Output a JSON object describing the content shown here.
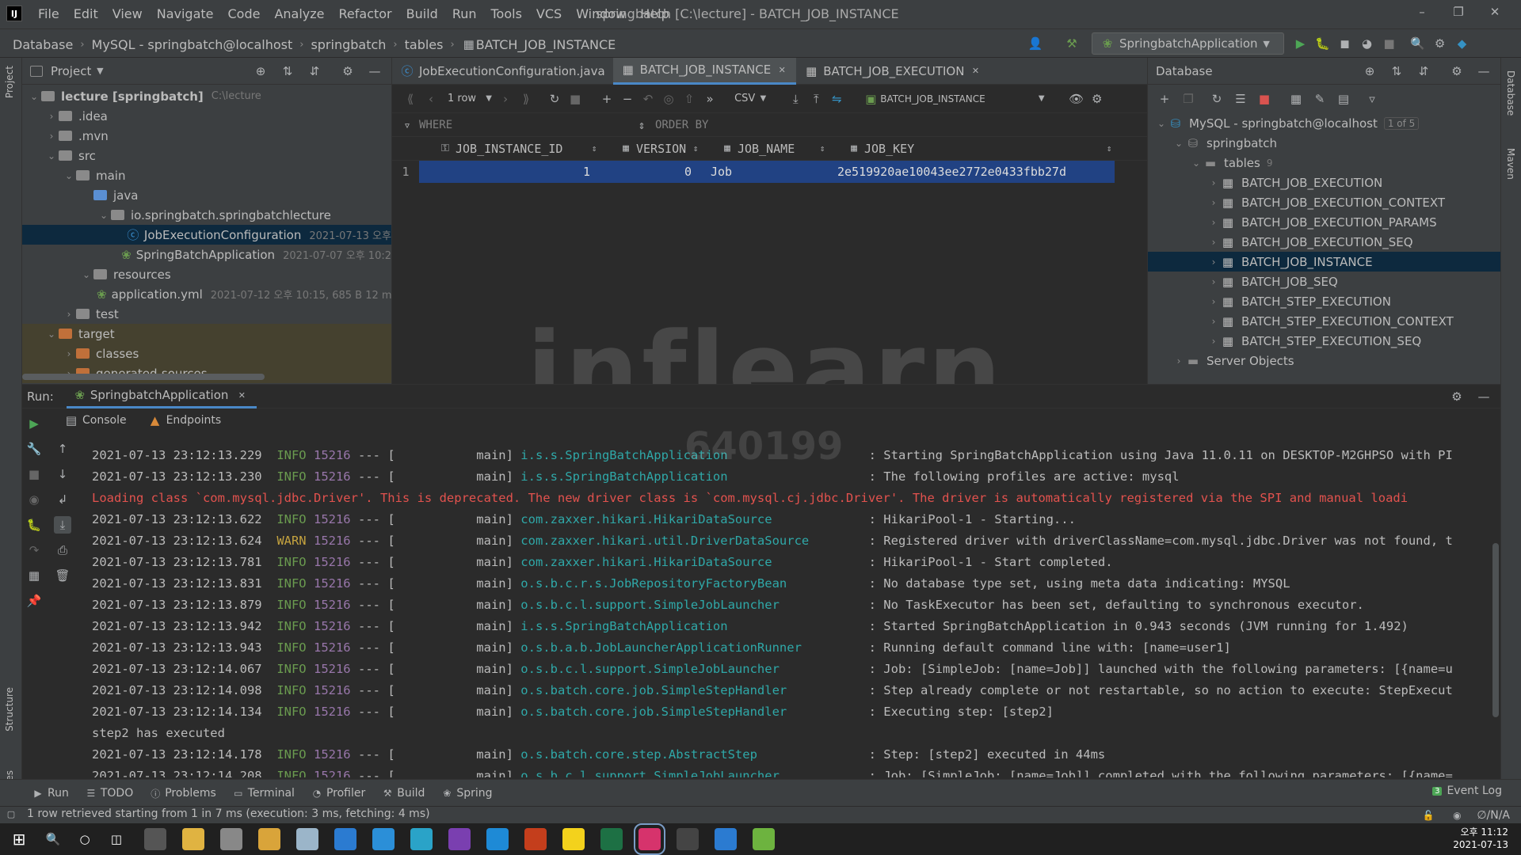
{
  "menu": {
    "items": [
      "File",
      "Edit",
      "View",
      "Navigate",
      "Code",
      "Analyze",
      "Refactor",
      "Build",
      "Run",
      "Tools",
      "VCS",
      "Window",
      "Help"
    ],
    "window_title": "springbatch [C:\\lecture] - BATCH_JOB_INSTANCE"
  },
  "breadcrumb": [
    "Database",
    "MySQL - springbatch@localhost",
    "springbatch",
    "tables",
    "BATCH_JOB_INSTANCE"
  ],
  "run_config": "SpringbatchApplication",
  "project": {
    "title": "Project",
    "tree": [
      {
        "label": "lecture [springbatch]",
        "meta": "C:\\lecture"
      },
      {
        "label": ".idea",
        "meta": ""
      },
      {
        "label": ".mvn",
        "meta": ""
      },
      {
        "label": "src",
        "meta": ""
      },
      {
        "label": "main",
        "meta": ""
      },
      {
        "label": "java",
        "meta": ""
      },
      {
        "label": "io.springbatch.springbatchlecture",
        "meta": ""
      },
      {
        "label": "JobExecutionConfiguration",
        "meta": "2021-07-13 오후"
      },
      {
        "label": "SpringBatchApplication",
        "meta": "2021-07-07 오후 10:2"
      },
      {
        "label": "resources",
        "meta": ""
      },
      {
        "label": "application.yml",
        "meta": "2021-07-12 오후 10:15, 685 B 12 m"
      },
      {
        "label": "test",
        "meta": ""
      },
      {
        "label": "target",
        "meta": ""
      },
      {
        "label": "classes",
        "meta": ""
      },
      {
        "label": "generated-sources",
        "meta": ""
      }
    ]
  },
  "editor": {
    "tabs": [
      {
        "label": "JobExecutionConfiguration.java"
      },
      {
        "label": "BATCH_JOB_INSTANCE"
      },
      {
        "label": "BATCH_JOB_EXECUTION"
      }
    ],
    "rows_label": "1 row",
    "export_format": "CSV",
    "datasource": "BATCH_JOB_INSTANCE",
    "where_label": "WHERE",
    "orderby_label": "ORDER BY",
    "columns": [
      "JOB_INSTANCE_ID",
      "VERSION",
      "JOB_NAME",
      "JOB_KEY"
    ],
    "rows": [
      {
        "num": "1",
        "id": "1",
        "version": "0",
        "name": "Job",
        "key": "2e519920ae10043ee2772e0433fbb27d"
      }
    ]
  },
  "database": {
    "title": "Database",
    "connection": "MySQL - springbatch@localhost",
    "connection_badge": "1 of 5",
    "schema": "springbatch",
    "tables_label": "tables",
    "tables_count": "9",
    "tables": [
      "BATCH_JOB_EXECUTION",
      "BATCH_JOB_EXECUTION_CONTEXT",
      "BATCH_JOB_EXECUTION_PARAMS",
      "BATCH_JOB_EXECUTION_SEQ",
      "BATCH_JOB_INSTANCE",
      "BATCH_JOB_SEQ",
      "BATCH_STEP_EXECUTION",
      "BATCH_STEP_EXECUTION_CONTEXT",
      "BATCH_STEP_EXECUTION_SEQ"
    ],
    "server_objects": "Server Objects"
  },
  "run": {
    "label": "Run:",
    "config": "SpringbatchApplication",
    "tabs": [
      "Console",
      "Endpoints"
    ],
    "logs": [
      {
        "kind": "log",
        "ts": "2021-07-13 23:12:13.229",
        "level": "INFO",
        "pid": "15216",
        "thread": "main",
        "logger": "i.s.s.SpringBatchApplication",
        "msg": "Starting SpringBatchApplication using Java 11.0.11 on DESKTOP-M2GHPSO with PI"
      },
      {
        "kind": "log",
        "ts": "2021-07-13 23:12:13.230",
        "level": "INFO",
        "pid": "15216",
        "thread": "main",
        "logger": "i.s.s.SpringBatchApplication",
        "msg": "The following profiles are active: mysql"
      },
      {
        "kind": "error",
        "text": "Loading class `com.mysql.jdbc.Driver'. This is deprecated. The new driver class is `com.mysql.cj.jdbc.Driver'. The driver is automatically registered via the SPI and manual loadi"
      },
      {
        "kind": "log",
        "ts": "2021-07-13 23:12:13.622",
        "level": "INFO",
        "pid": "15216",
        "thread": "main",
        "logger": "com.zaxxer.hikari.HikariDataSource",
        "msg": "HikariPool-1 - Starting..."
      },
      {
        "kind": "log",
        "ts": "2021-07-13 23:12:13.624",
        "level": "WARN",
        "pid": "15216",
        "thread": "main",
        "logger": "com.zaxxer.hikari.util.DriverDataSource",
        "msg": "Registered driver with driverClassName=com.mysql.jdbc.Driver was not found, t"
      },
      {
        "kind": "log",
        "ts": "2021-07-13 23:12:13.781",
        "level": "INFO",
        "pid": "15216",
        "thread": "main",
        "logger": "com.zaxxer.hikari.HikariDataSource",
        "msg": "HikariPool-1 - Start completed."
      },
      {
        "kind": "log",
        "ts": "2021-07-13 23:12:13.831",
        "level": "INFO",
        "pid": "15216",
        "thread": "main",
        "logger": "o.s.b.c.r.s.JobRepositoryFactoryBean",
        "msg": "No database type set, using meta data indicating: MYSQL"
      },
      {
        "kind": "log",
        "ts": "2021-07-13 23:12:13.879",
        "level": "INFO",
        "pid": "15216",
        "thread": "main",
        "logger": "o.s.b.c.l.support.SimpleJobLauncher",
        "msg": "No TaskExecutor has been set, defaulting to synchronous executor."
      },
      {
        "kind": "log",
        "ts": "2021-07-13 23:12:13.942",
        "level": "INFO",
        "pid": "15216",
        "thread": "main",
        "logger": "i.s.s.SpringBatchApplication",
        "msg": "Started SpringBatchApplication in 0.943 seconds (JVM running for 1.492)"
      },
      {
        "kind": "log",
        "ts": "2021-07-13 23:12:13.943",
        "level": "INFO",
        "pid": "15216",
        "thread": "main",
        "logger": "o.s.b.a.b.JobLauncherApplicationRunner",
        "msg": "Running default command line with: [name=user1]"
      },
      {
        "kind": "log",
        "ts": "2021-07-13 23:12:14.067",
        "level": "INFO",
        "pid": "15216",
        "thread": "main",
        "logger": "o.s.b.c.l.support.SimpleJobLauncher",
        "msg": "Job: [SimpleJob: [name=Job]] launched with the following parameters: [{name=u"
      },
      {
        "kind": "log",
        "ts": "2021-07-13 23:12:14.098",
        "level": "INFO",
        "pid": "15216",
        "thread": "main",
        "logger": "o.s.batch.core.job.SimpleStepHandler",
        "msg": "Step already complete or not restartable, so no action to execute: StepExecut"
      },
      {
        "kind": "log",
        "ts": "2021-07-13 23:12:14.134",
        "level": "INFO",
        "pid": "15216",
        "thread": "main",
        "logger": "o.s.batch.core.job.SimpleStepHandler",
        "msg": "Executing step: [step2]"
      },
      {
        "kind": "plain",
        "text": "step2 has executed"
      },
      {
        "kind": "log",
        "ts": "2021-07-13 23:12:14.178",
        "level": "INFO",
        "pid": "15216",
        "thread": "main",
        "logger": "o.s.batch.core.step.AbstractStep",
        "msg": "Step: [step2] executed in 44ms"
      },
      {
        "kind": "log",
        "ts": "2021-07-13 23:12:14.208",
        "level": "INFO",
        "pid": "15216",
        "thread": "main",
        "logger": "o.s.b.c.l.support.SimpleJobLauncher",
        "msg": "Job: [SimpleJob: [name=Job]] completed with the following parameters: [{name="
      }
    ]
  },
  "bottom_tools": [
    "Run",
    "TODO",
    "Problems",
    "Terminal",
    "Profiler",
    "Build",
    "Spring"
  ],
  "event_log": {
    "count": "3",
    "label": "Event Log"
  },
  "status": {
    "message": "1 row retrieved starting from 1 in 7 ms (execution: 3 ms, fetching: 4 ms)",
    "right": "∅/N/A"
  },
  "clock": {
    "time": "오후 11:12",
    "date": "2021-07-13"
  },
  "watermark": {
    "brand": "inflearn",
    "code": "640199"
  },
  "side_labels": {
    "project": "Project",
    "structure": "Structure",
    "favorites": "Favorites",
    "database": "Database",
    "maven": "Maven"
  },
  "colors": {
    "accent": "#2d5a8c",
    "selection": "#0d293e",
    "info": "#6a9b4f",
    "warn": "#c5a33f",
    "error": "#e2524e"
  }
}
